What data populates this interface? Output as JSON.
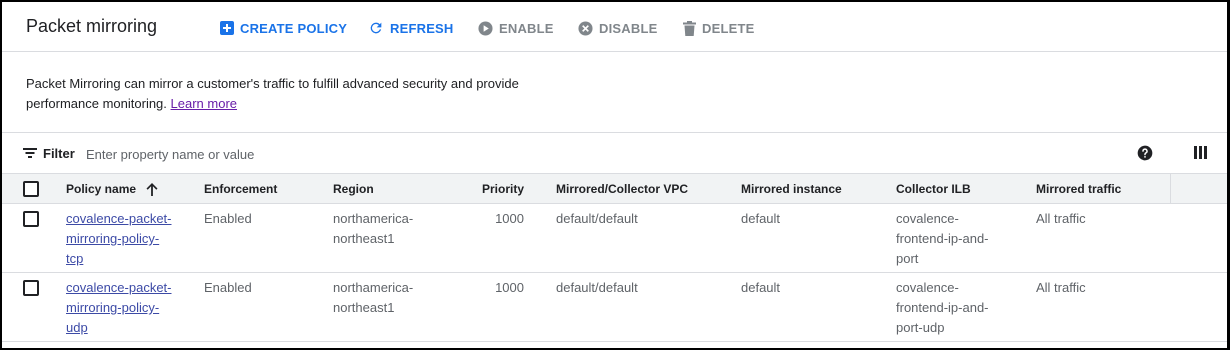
{
  "header": {
    "title": "Packet mirroring",
    "toolbar": {
      "create_label": "CREATE POLICY",
      "refresh_label": "REFRESH",
      "enable_label": "ENABLE",
      "disable_label": "DISABLE",
      "delete_label": "DELETE"
    }
  },
  "description": {
    "text": "Packet Mirroring can mirror a customer's traffic to fulfill advanced security and provide performance monitoring.",
    "link_label": "Learn more"
  },
  "filter": {
    "label": "Filter",
    "placeholder": "Enter property name or value"
  },
  "table": {
    "columns": {
      "policy_name": "Policy name",
      "enforcement": "Enforcement",
      "region": "Region",
      "priority": "Priority",
      "vpc": "Mirrored/Collector VPC",
      "instance": "Mirrored instance",
      "ilb": "Collector ILB",
      "traffic": "Mirrored traffic"
    },
    "rows": [
      {
        "name_lines": [
          "covalence-packet-",
          "mirroring-policy-",
          "tcp"
        ],
        "enforcement": "Enabled",
        "region_lines": [
          "northamerica-",
          "northeast1"
        ],
        "priority": "1000",
        "vpc": "default/default",
        "instance": "default",
        "ilb_lines": [
          "covalence-",
          "frontend-ip-and-",
          "port"
        ],
        "traffic": "All traffic"
      },
      {
        "name_lines": [
          "covalence-packet-",
          "mirroring-policy-",
          "udp"
        ],
        "enforcement": "Enabled",
        "region_lines": [
          "northamerica-",
          "northeast1"
        ],
        "priority": "1000",
        "vpc": "default/default",
        "instance": "default",
        "ilb_lines": [
          "covalence-",
          "frontend-ip-and-",
          "port-udp"
        ],
        "traffic": "All traffic"
      }
    ]
  },
  "icons": {
    "create": "add-box-icon",
    "refresh": "refresh-icon",
    "enable": "play-circle-icon",
    "disable": "cancel-circle-icon",
    "delete": "trash-icon",
    "filter": "filter-list-icon",
    "sort": "arrow-up-icon",
    "help": "help-icon",
    "columns": "view-columns-icon"
  },
  "colors": {
    "primary": "#1a73e8",
    "disabled": "#80868b",
    "link": "#3c4aa6",
    "visited_link": "#681da8",
    "header_bg": "#f1f3f4",
    "border": "#dadce0"
  }
}
